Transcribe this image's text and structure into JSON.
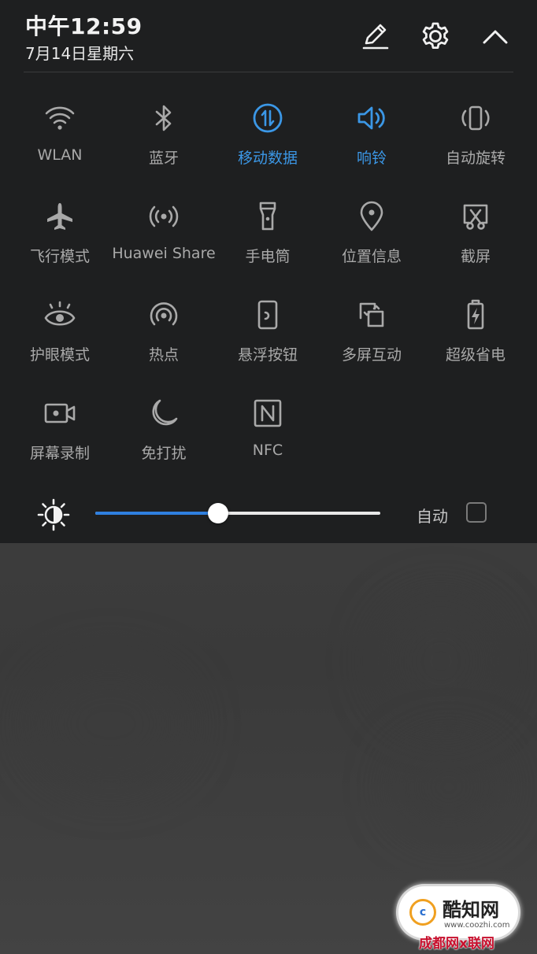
{
  "status": {
    "time": "中午12:59",
    "date": "7月14日星期六"
  },
  "header_icons": {
    "edit": "pencil-icon",
    "settings": "gear-icon",
    "collapse": "chevron-up-icon"
  },
  "tiles": [
    {
      "label": "WLAN",
      "icon": "wifi-icon",
      "active": false
    },
    {
      "label": "蓝牙",
      "icon": "bluetooth-icon",
      "active": false
    },
    {
      "label": "移动数据",
      "icon": "mobile-data-icon",
      "active": true
    },
    {
      "label": "响铃",
      "icon": "speaker-icon",
      "active": true
    },
    {
      "label": "自动旋转",
      "icon": "auto-rotate-icon",
      "active": false
    },
    {
      "label": "飞行模式",
      "icon": "airplane-icon",
      "active": false
    },
    {
      "label": "Huawei Share",
      "icon": "huawei-share-icon",
      "active": false
    },
    {
      "label": "手电筒",
      "icon": "flashlight-icon",
      "active": false
    },
    {
      "label": "位置信息",
      "icon": "location-pin-icon",
      "active": false
    },
    {
      "label": "截屏",
      "icon": "screenshot-icon",
      "active": false
    },
    {
      "label": "护眼模式",
      "icon": "eye-icon",
      "active": false
    },
    {
      "label": "热点",
      "icon": "hotspot-icon",
      "active": false
    },
    {
      "label": "悬浮按钮",
      "icon": "floating-button-icon",
      "active": false
    },
    {
      "label": "多屏互动",
      "icon": "multi-screen-icon",
      "active": false
    },
    {
      "label": "超级省电",
      "icon": "battery-saver-icon",
      "active": false
    },
    {
      "label": "屏幕录制",
      "icon": "screen-record-icon",
      "active": false
    },
    {
      "label": "免打扰",
      "icon": "moon-icon",
      "active": false
    },
    {
      "label": "NFC",
      "icon": "nfc-icon",
      "active": false
    }
  ],
  "brightness": {
    "icon": "brightness-icon",
    "level": 0.43,
    "auto_label": "自动",
    "auto_checked": false
  },
  "colors": {
    "active": "#3b97e6",
    "inactive": "#a9a9a9",
    "shade_bg": "#1e1f20",
    "slider_fill": "#2f80e0"
  },
  "watermark": {
    "title": "酷知网",
    "url": "www.coozhi.com",
    "bottom_text": "成都网x联网"
  }
}
